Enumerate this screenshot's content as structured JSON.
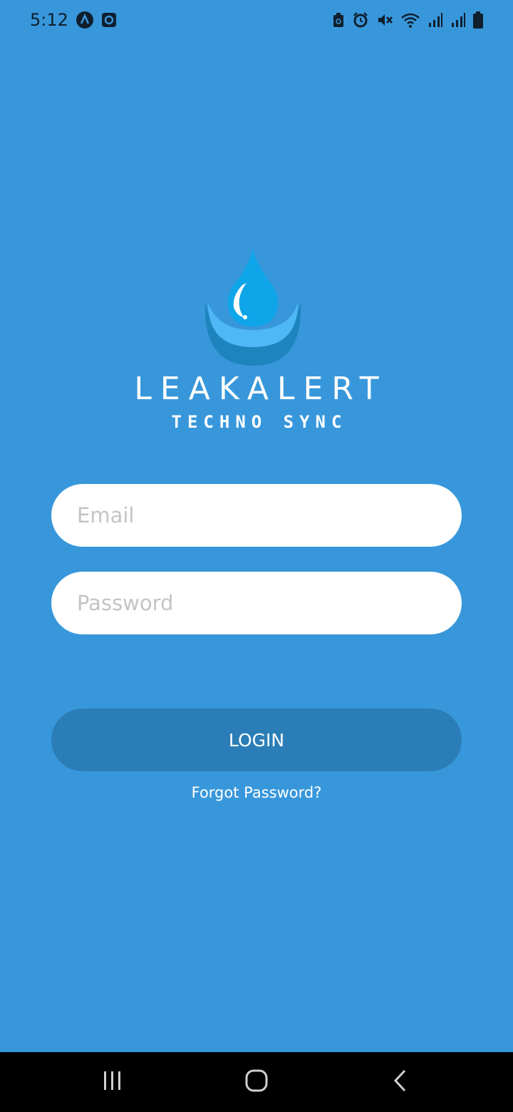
{
  "status_bar": {
    "time": "5:12",
    "left_icons": [
      "app-a-icon",
      "app-square-icon"
    ],
    "right_icons": [
      "battery-saver-icon",
      "alarm-icon",
      "mute-icon",
      "wifi-icon",
      "signal-1-icon",
      "signal-2-icon",
      "battery-icon"
    ]
  },
  "logo": {
    "name": "water-drop-logo",
    "brand": "LEAKALERT",
    "tagline": "TECHNO SYNC"
  },
  "form": {
    "email_placeholder": "Email",
    "email_value": "",
    "password_placeholder": "Password",
    "password_value": "",
    "login_label": "LOGIN",
    "forgot_label": "Forgot Password?"
  },
  "nav_bar": {
    "icons": [
      "recents-icon",
      "home-icon",
      "back-icon"
    ]
  },
  "colors": {
    "background": "#3897DB",
    "login_button": "#2B7DB7",
    "field": "#FFFFFF",
    "nav_bar": "#000000"
  }
}
